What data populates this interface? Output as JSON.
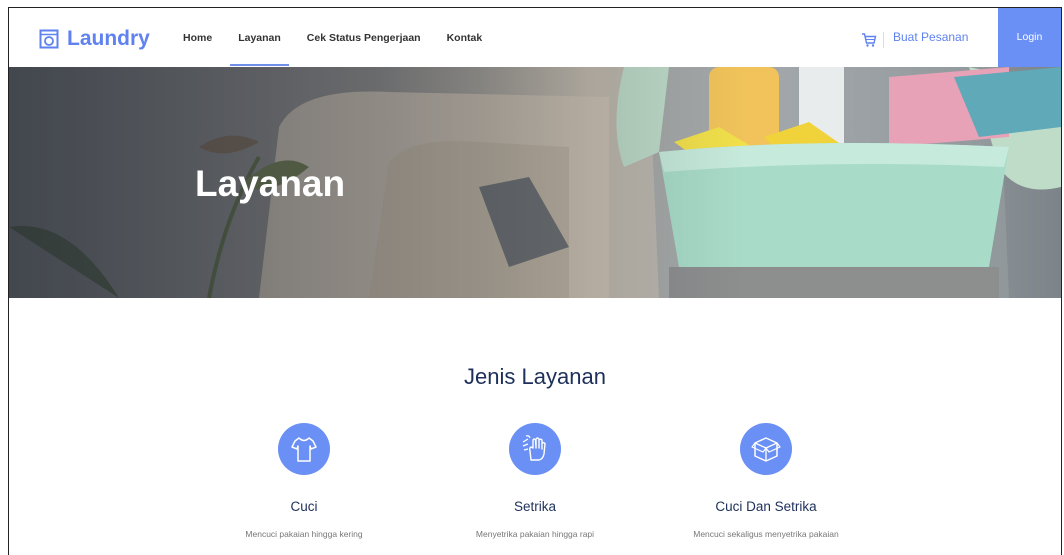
{
  "brand": {
    "name": "Laundry"
  },
  "nav": {
    "items": [
      {
        "label": "Home"
      },
      {
        "label": "Layanan"
      },
      {
        "label": "Cek Status Pengerjaan"
      },
      {
        "label": "Kontak"
      }
    ],
    "active": "Layanan",
    "order_label": "Buat Pesanan",
    "login_label": "Login"
  },
  "hero": {
    "title": "Layanan"
  },
  "services": {
    "title": "Jenis Layanan",
    "items": [
      {
        "name": "Cuci",
        "desc": "Mencuci pakaian hingga kering",
        "icon": "shirt-icon"
      },
      {
        "name": "Setrika",
        "desc": "Menyetrika pakaian hingga rapi",
        "icon": "ironing-hand-icon"
      },
      {
        "name": "Cuci Dan Setrika",
        "desc": "Mencuci sekaligus menyetrika pakaian",
        "icon": "box-icon"
      }
    ]
  },
  "colors": {
    "accent": "#6a8ff5",
    "heading": "#1d2f5a"
  }
}
